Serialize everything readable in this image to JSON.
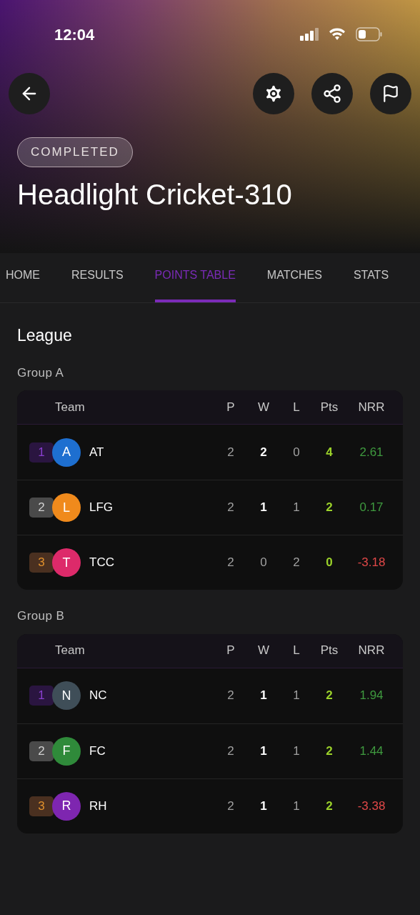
{
  "status_bar": {
    "time": "12:04"
  },
  "header": {
    "badge": "COMPLETED",
    "title": "Headlight Cricket-310"
  },
  "tabs": [
    {
      "label": "HOME",
      "selected": false
    },
    {
      "label": "RESULTS",
      "selected": false
    },
    {
      "label": "POINTS TABLE",
      "selected": true
    },
    {
      "label": "MATCHES",
      "selected": false
    },
    {
      "label": "STATS",
      "selected": false
    }
  ],
  "section_title": "League",
  "groups": [
    {
      "name": "Group A",
      "columns": [
        "Team",
        "P",
        "W",
        "L",
        "Pts",
        "NRR"
      ],
      "rows": [
        {
          "rank": "1",
          "initial": "A",
          "color": "#1e6fd0",
          "team": "AT",
          "p": "2",
          "w": "2",
          "w_highlighted": true,
          "l": "0",
          "pts": "4",
          "nrr": "2.61",
          "nrr_negative": false
        },
        {
          "rank": "2",
          "initial": "L",
          "color": "#f08a1c",
          "team": "LFG",
          "p": "2",
          "w": "1",
          "w_highlighted": true,
          "l": "1",
          "pts": "2",
          "nrr": "0.17",
          "nrr_negative": false
        },
        {
          "rank": "3",
          "initial": "T",
          "color": "#dd2a6a",
          "team": "TCC",
          "p": "2",
          "w": "0",
          "w_highlighted": false,
          "l": "2",
          "pts": "0",
          "nrr": "-3.18",
          "nrr_negative": true
        }
      ]
    },
    {
      "name": "Group B",
      "columns": [
        "Team",
        "P",
        "W",
        "L",
        "Pts",
        "NRR"
      ],
      "rows": [
        {
          "rank": "1",
          "initial": "N",
          "color": "#3f4e58",
          "team": "NC",
          "p": "2",
          "w": "1",
          "w_highlighted": true,
          "l": "1",
          "pts": "2",
          "nrr": "1.94",
          "nrr_negative": false
        },
        {
          "rank": "2",
          "initial": "F",
          "color": "#2f8a3a",
          "team": "FC",
          "p": "2",
          "w": "1",
          "w_highlighted": true,
          "l": "1",
          "pts": "2",
          "nrr": "1.44",
          "nrr_negative": false
        },
        {
          "rank": "3",
          "initial": "R",
          "color": "#7e26b0",
          "team": "RH",
          "p": "2",
          "w": "1",
          "w_highlighted": true,
          "l": "1",
          "pts": "2",
          "nrr": "-3.38",
          "nrr_negative": true
        }
      ]
    }
  ]
}
